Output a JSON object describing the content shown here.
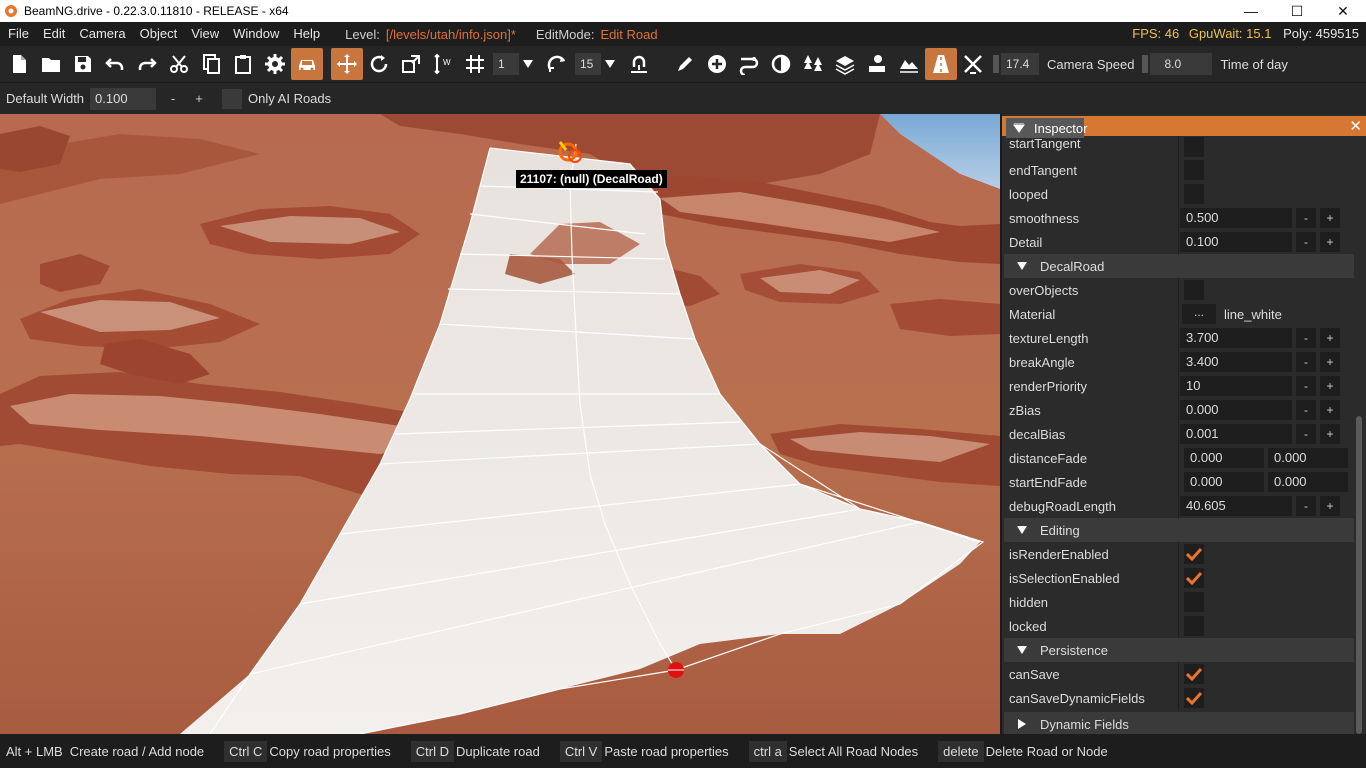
{
  "window": {
    "title": "BeamNG.drive - 0.22.3.0.11810 - RELEASE - x64",
    "minimize": "—",
    "maximize": "☐",
    "close": "✕"
  },
  "menu": {
    "items": [
      "File",
      "Edit",
      "Camera",
      "Object",
      "View",
      "Window",
      "Help"
    ],
    "level_label": "Level:",
    "level_value": "[/levels/utah/info.json]*",
    "editmode_label": "EditMode:",
    "editmode_value": "Edit Road",
    "fps": "FPS: 46",
    "gpuwait": "GpuWait: 15.1",
    "poly": "Poly: 459515"
  },
  "toolbar": {
    "snap_value": "1",
    "rotate_value": "15",
    "camera_speed_value": "17.4",
    "camera_speed_label": "Camera Speed",
    "time_of_day_value": "8.0",
    "time_of_day_label": "Time of day"
  },
  "subbar": {
    "default_width_label": "Default Width",
    "default_width_value": "0.100",
    "minus": "-",
    "plus": "+",
    "only_ai_label": "Only AI Roads"
  },
  "viewport": {
    "object_label": "21107: (null) (DecalRoad)"
  },
  "inspector": {
    "title": "Inspector",
    "close": "✕",
    "rows_top": {
      "startTangent": "startTangent",
      "endTangent": "endTangent",
      "looped": "looped",
      "smoothness_label": "smoothness",
      "smoothness_value": "0.500",
      "detail_label": "Detail",
      "detail_value": "0.100"
    },
    "decalroad_section": "DecalRoad",
    "decalroad": {
      "overObjects": "overObjects",
      "material_label": "Material",
      "material_button": "...",
      "material_value": "line_white",
      "textureLength_label": "textureLength",
      "textureLength_value": "3.700",
      "breakAngle_label": "breakAngle",
      "breakAngle_value": "3.400",
      "renderPriority_label": "renderPriority",
      "renderPriority_value": "10",
      "zBias_label": "zBias",
      "zBias_value": "0.000",
      "decalBias_label": "decalBias",
      "decalBias_value": "0.001",
      "distanceFade_label": "distanceFade",
      "distanceFade_a": "0.000",
      "distanceFade_b": "0.000",
      "startEndFade_label": "startEndFade",
      "startEndFade_a": "0.000",
      "startEndFade_b": "0.000",
      "debugRoadLength_label": "debugRoadLength",
      "debugRoadLength_value": "40.605"
    },
    "editing_section": "Editing",
    "editing": {
      "isRenderEnabled": "isRenderEnabled",
      "isSelectionEnabled": "isSelectionEnabled",
      "hidden": "hidden",
      "locked": "locked"
    },
    "persistence_section": "Persistence",
    "persistence": {
      "canSave": "canSave",
      "canSaveDynamicFields": "canSaveDynamicFields"
    },
    "dynamic_section": "Dynamic Fields",
    "minus": "-",
    "plus": "+"
  },
  "statusbar": {
    "items": [
      {
        "key": "Alt + LMB",
        "desc": "Create road / Add node"
      },
      {
        "key": "Ctrl C",
        "desc": "Copy road properties"
      },
      {
        "key": "Ctrl D",
        "desc": "Duplicate road"
      },
      {
        "key": "Ctrl V",
        "desc": "Paste road properties"
      },
      {
        "key": "ctrl a",
        "desc": "Select All Road Nodes"
      },
      {
        "key": "delete",
        "desc": "Delete Road or Node"
      }
    ]
  },
  "colors": {
    "accent_orange": "#d77832",
    "fps_yellow": "#f0c24c",
    "level_orange": "#e0703a",
    "check_orange": "#e8762c"
  },
  "icons": {
    "toolbar": [
      "new-file-icon",
      "open-folder-icon",
      "save-icon",
      "undo-icon",
      "redo-icon",
      "cut-icon",
      "copy-icon",
      "paste-icon",
      "settings-icon",
      "vehicle-icon",
      "move-gizmo-icon",
      "rotate-gizmo-icon",
      "scale-gizmo-icon",
      "snap-icon",
      "grid-icon",
      "rotation-snap-icon",
      "drop-to-ground-icon",
      "pencil-icon",
      "add-circle-icon",
      "road-edit-icon",
      "terrain-paint-icon",
      "forest-icon",
      "material-icon",
      "objects-icon",
      "terrain-icon",
      "road-icon",
      "mesh-road-icon"
    ]
  }
}
